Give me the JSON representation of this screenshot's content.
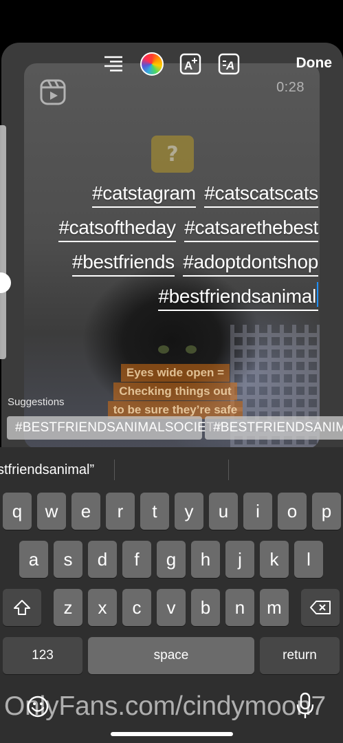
{
  "toolbar": {
    "done_label": "Done",
    "text_effect_icon": "text-effect-icon",
    "text_background_icon": "text-background-icon",
    "align_icon": "text-align-icon",
    "color_icon": "color-wheel-icon"
  },
  "preview": {
    "timer": "0:28",
    "sticker_glyph": "?",
    "caption_lines": [
      "Eyes wide open =",
      "Checking things out",
      "to be sure they’re safe"
    ]
  },
  "hashtags": {
    "lines": [
      [
        "#catstagram",
        "#catscatscats"
      ],
      [
        "#catsoftheday",
        "#catsarethebest"
      ],
      [
        "#bestfriends",
        "#adoptdontshop"
      ],
      [
        "#bestfriendsanimal"
      ]
    ]
  },
  "suggestions": {
    "label": "Suggestions",
    "chips": [
      "#BESTFRIENDSANIMALSOCIETY",
      "#BESTFRIENDSANIMAL"
    ]
  },
  "keyboard": {
    "prediction": "stfriendsanimal”",
    "row1": [
      "q",
      "w",
      "e",
      "r",
      "t",
      "y",
      "u",
      "i",
      "o",
      "p"
    ],
    "row2": [
      "a",
      "s",
      "d",
      "f",
      "g",
      "h",
      "j",
      "k",
      "l"
    ],
    "row3": [
      "z",
      "x",
      "c",
      "v",
      "b",
      "n",
      "m"
    ],
    "numbers_label": "123",
    "space_label": "space",
    "return_label": "return"
  },
  "watermark": "OnlyFans.com/cindymoon7",
  "colors": {
    "cursor": "#1e90ff",
    "key": "#6b6b6b",
    "key_dark": "#474747",
    "keyboard_bg": "#2f2f2f"
  }
}
